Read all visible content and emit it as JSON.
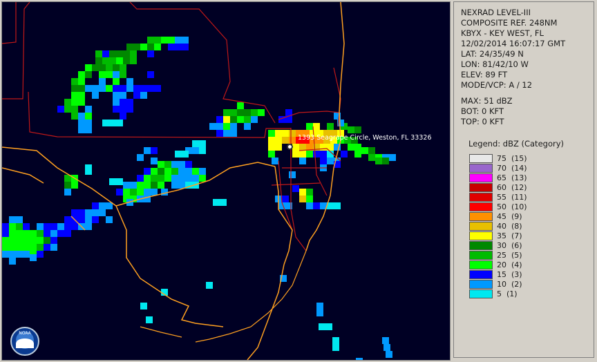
{
  "panel": {
    "product": "NEXRAD LEVEL-III",
    "mode": "COMPOSITE REF. 248NM",
    "station": "KBYX - KEY WEST, FL",
    "datetime": "12/02/2014 16:07:17 GMT",
    "lat": "LAT: 24/35/49 N",
    "lon": "LON: 81/42/10 W",
    "elev": "ELEV: 89 FT",
    "vcp": "MODE/VCP: A / 12",
    "max": "MAX: 51 dBZ",
    "bot": "BOT: 0 KFT",
    "top": "TOP: 0 KFT"
  },
  "legend": {
    "title": "Legend: dBZ (Category)",
    "items": [
      {
        "label": "75  (15)",
        "color": "#e8e8e8"
      },
      {
        "label": "70  (14)",
        "color": "#9966cc"
      },
      {
        "label": "65  (13)",
        "color": "#ff00ff"
      },
      {
        "label": "60  (12)",
        "color": "#c80000"
      },
      {
        "label": "55  (11)",
        "color": "#e00000"
      },
      {
        "label": "50  (10)",
        "color": "#ff0000"
      },
      {
        "label": "45  (9)",
        "color": "#ff9000"
      },
      {
        "label": "40  (8)",
        "color": "#e8c000"
      },
      {
        "label": "35  (7)",
        "color": "#ffff00"
      },
      {
        "label": "30  (6)",
        "color": "#008800"
      },
      {
        "label": "25  (5)",
        "color": "#00bb00"
      },
      {
        "label": "20  (4)",
        "color": "#00ff00"
      },
      {
        "label": "15  (3)",
        "color": "#0000ff"
      },
      {
        "label": "10  (2)",
        "color": "#0099ff"
      },
      {
        "label": "5  (1)",
        "color": "#00e8f0"
      }
    ]
  },
  "map": {
    "location_label": "1393 Seagrape Circle, Weston, FL 33326",
    "logo_text": "NOAA",
    "coast_color": "#ffa020",
    "county_color": "#c01818"
  }
}
